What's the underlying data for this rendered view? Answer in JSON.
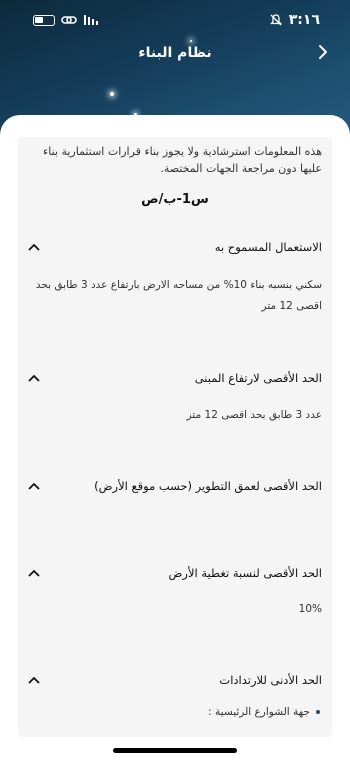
{
  "status_bar": {
    "time": "٣:١٦"
  },
  "nav": {
    "title": "نظام البناء",
    "back_icon": "chevron-icon"
  },
  "card": {
    "disclaimer": "هذه المعلومات استرشادية ولا يجوز بناء قرارات استثمارية بناء عليها دون مراجعة الجهات المختصة.",
    "code": "س1-ب/ص",
    "sections": [
      {
        "title": "الاستعمال المسموح به",
        "body": "سكني بنسبه بناء 10% من مساحه الارض بارتفاع عدد 3 طابق بحد اقصى 12 متر"
      },
      {
        "title": "الحد الأقصى لارتفاع المبنى",
        "body": "عدد 3 طابق بحد اقصى 12 متر"
      },
      {
        "title": "الحد الأقصى لعمق التطوير (حسب موقع الأرض)",
        "body": ""
      },
      {
        "title": "الحد الأقصى لنسبة تغطية الأرض",
        "body": "10%"
      },
      {
        "title": "الحد الأدنى للارتدادات",
        "bullet": "جهة الشوارع الرئيسية :"
      }
    ]
  }
}
